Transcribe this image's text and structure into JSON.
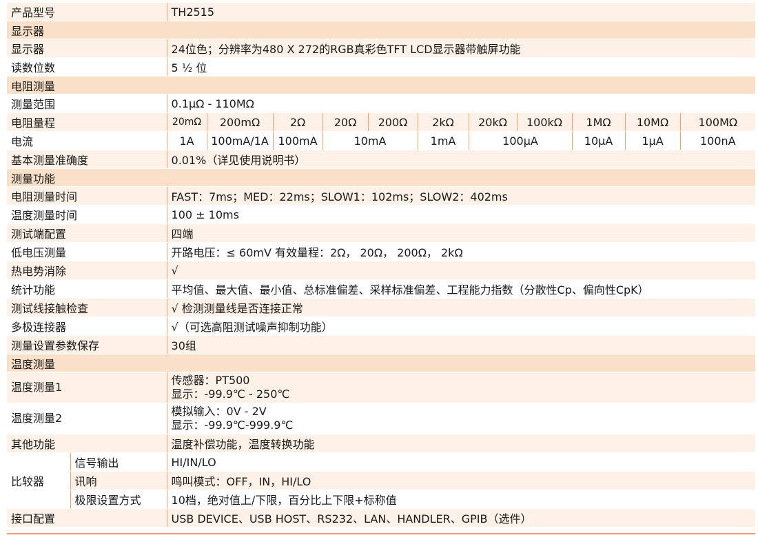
{
  "rows": {
    "model_label": "产品型号",
    "model_value": "TH2515",
    "sec_display": "显示器",
    "display_label": "显示器",
    "display_value": "24位色；分辨率为480 X 272的RGB真彩色TFT LCD显示器带触屏功能",
    "digits_label": "读数位数",
    "digits_value": "5 ½ 位",
    "sec_resistance": "电阻测量",
    "range_label": "测量范围",
    "range_value": "0.1μΩ - 110MΩ",
    "ranges_label": "电阻量程",
    "ranges": [
      "20mΩ",
      "200mΩ",
      "2Ω",
      "20Ω",
      "200Ω",
      "2kΩ",
      "20kΩ",
      "100kΩ",
      "1MΩ",
      "10MΩ",
      "100MΩ"
    ],
    "current_label": "电流",
    "currents": [
      "1A",
      "100mA/1A",
      "100mA",
      "10mA",
      "1mA",
      "100μA",
      "10μA",
      "1μA",
      "100nA"
    ],
    "accuracy_label": "基本测量准确度",
    "accuracy_value": "0.01%（详见使用说明书）",
    "sec_functions": "测量功能",
    "rtime_label": "电阻测量时间",
    "rtime_value": "FAST：7ms；MED：22ms；SLOW1：102ms；SLOW2：402ms",
    "ttime_label": "温度测量时间",
    "ttime_value": "100 ± 10ms",
    "terminal_label": "测试端配置",
    "terminal_value": "四端",
    "lowv_label": "低电压测量",
    "lowv_value": "开路电压：≤ 60mV 有效量程：2Ω， 20Ω， 200Ω， 2kΩ",
    "thermal_label": "热电势消除",
    "thermal_value": "√",
    "stats_label": "统计功能",
    "stats_value": "平均值、最大值、最小值、总标准偏差、采样标准偏差、工程能力指数（分散性Cp、偏向性CpK）",
    "contact_label": "测试线接触检查",
    "contact_value": "√ 检测测量线是否连接正常",
    "multi_label": "多极连接器",
    "multi_value": "√（可选高阻测试噪声抑制功能）",
    "save_label": "测量设置参数保存",
    "save_value": "30组",
    "sec_temp": "温度测量",
    "temp1_label": "温度测量1",
    "temp1_line1": "传感器：PT500",
    "temp1_line2": "显示：-99.9℃ - 250℃",
    "temp2_label": "温度测量2",
    "temp2_line1": "模拟输入：0V - 2V",
    "temp2_line2": "显示：-99.9℃-999.9℃",
    "other_label": "其他功能",
    "other_value": "温度补偿功能，温度转换功能",
    "comparator_label": "比较器",
    "signal_label": "信号输出",
    "signal_value": "HI/IN/LO",
    "beep_label": "讯响",
    "beep_value": "鸣叫模式：OFF，IN，HI/LO",
    "limit_label": "极限设置方式",
    "limit_value": "10档，绝对值上/下限，百分比上下限+标称值",
    "interface_label": "接口配置",
    "interface_value": "USB DEVICE、USB HOST、RS232、LAN、HANDLER、GPIB（选件）"
  }
}
